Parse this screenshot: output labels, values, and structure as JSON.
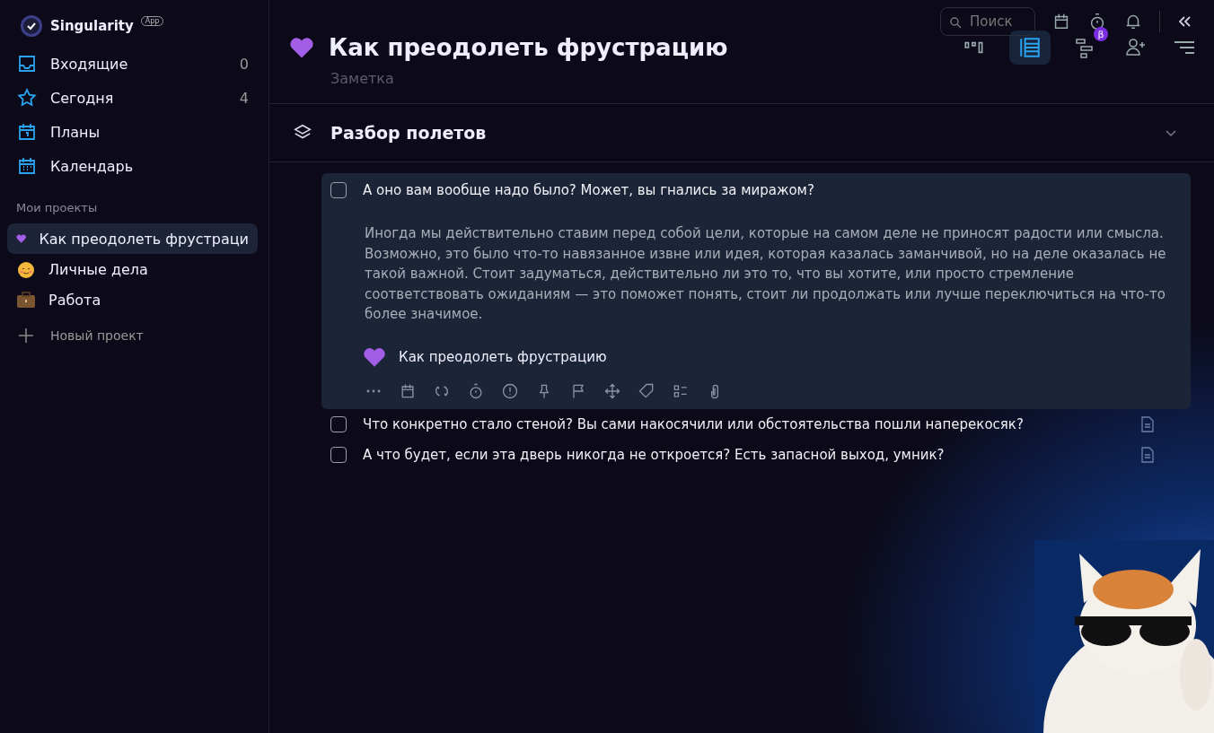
{
  "app": {
    "name": "Singularity",
    "badge": "App"
  },
  "nav": [
    {
      "label": "Входящие",
      "count": "0"
    },
    {
      "label": "Сегодня",
      "count": "4"
    },
    {
      "label": "Планы"
    },
    {
      "label": "Календарь"
    }
  ],
  "projects_heading": "Мои проекты",
  "projects": [
    {
      "label": "Как преодолеть фрустраци",
      "selected": true
    },
    {
      "label": "Личные дела",
      "selected": false
    },
    {
      "label": "Работа",
      "selected": false
    }
  ],
  "new_project": "Новый проект",
  "search": {
    "placeholder": "Поиск"
  },
  "view_badge": "β",
  "page": {
    "title": "Как преодолеть фрустрацию",
    "subtitle": "Заметка"
  },
  "section": {
    "title": "Разбор полетов"
  },
  "tasks": [
    {
      "title": "А оно вам вообще надо было? Может, вы гнались за миражом?",
      "checked": false,
      "expanded": true,
      "description": "Иногда мы действительно ставим перед собой цели, которые на самом деле не приносят радости или смысла. Возможно, это было что-то навязанное извне или идея, которая казалась заманчивой, но на деле оказалась не такой важной. Стоит задуматься, действительно ли это то, что вы хотите, или просто стремление соответствовать ожиданиям — это поможет понять, стоит ли продолжать или лучше переключиться на что-то более значимое.",
      "project": "Как преодолеть фрустрацию"
    },
    {
      "title": "Что конкретно стало стеной? Вы сами накосячили или обстоятельства пошли наперекосяк?",
      "checked": false,
      "expanded": false
    },
    {
      "title": "А что будет, если эта дверь никогда не откроется? Есть запасной выход, умник?",
      "checked": false,
      "expanded": false
    }
  ]
}
